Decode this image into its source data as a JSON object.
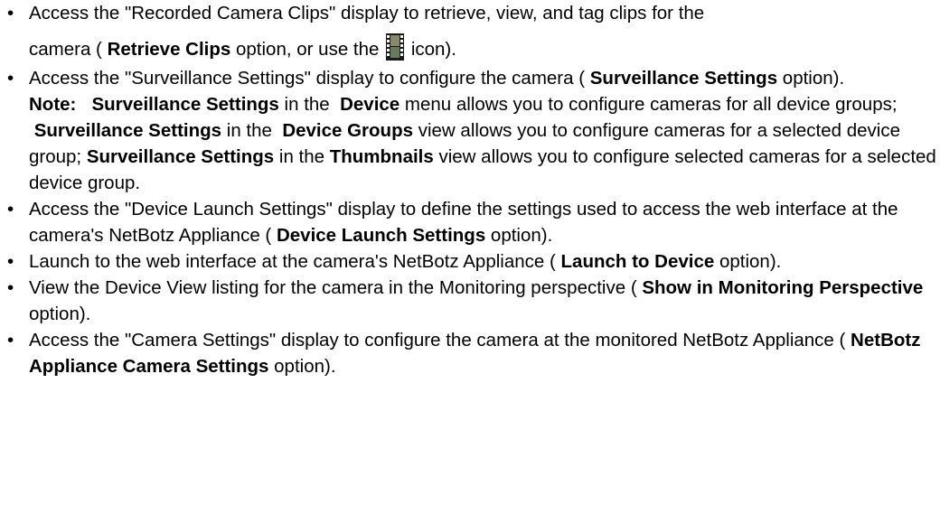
{
  "items": [
    {
      "cut_text": "Access the \"Recorded Camera Clips\" display to retrieve, view, and tag clips for the",
      "line2_pre": "camera ( ",
      "line2_bold": "Retrieve Clips",
      "line2_mid": " option, or use the ",
      "icon": "film-strip-icon",
      "line2_post": " icon)."
    },
    {
      "t1": "Access the \"Surveillance Settings\" display to configure the camera ( ",
      "b1": "Surveillance Settings",
      "t2": " option).",
      "note_label": "Note:",
      "n1": "Surveillance Settings",
      "n2": " in the ",
      "n3": "Device",
      "n4": " menu allows you to configure cameras for all device groups; ",
      "n5": "Surveillance Settings",
      "n6": " in the ",
      "n7": "Device Groups",
      "n8": " view allows you to configure cameras for a selected device group; ",
      "n9": "Surveillance Settings",
      "n10": " in the ",
      "n11": "Thumbnails",
      "n12": " view allows you to configure selected cameras for a selected device group."
    },
    {
      "t1": "Access the \"Device Launch Settings\" display to define the settings used to access the web interface at the camera's NetBotz Appliance ( ",
      "b1": "Device Launch Settings",
      "t2": " option)."
    },
    {
      "t1": "Launch to the web interface at the camera's NetBotz Appliance ( ",
      "b1": "Launch to Device",
      "t2": " option)."
    },
    {
      "t1": "View the Device View listing for the camera in the Monitoring perspective ( ",
      "b1": "Show in Monitoring Perspective",
      "t2": " option)."
    },
    {
      "t1": "Access the \"Camera Settings\" display to configure the camera at the monitored NetBotz Appliance ( ",
      "b1": "NetBotz Appliance Camera Settings",
      "t2": " option)."
    }
  ],
  "bullet_char": "•"
}
